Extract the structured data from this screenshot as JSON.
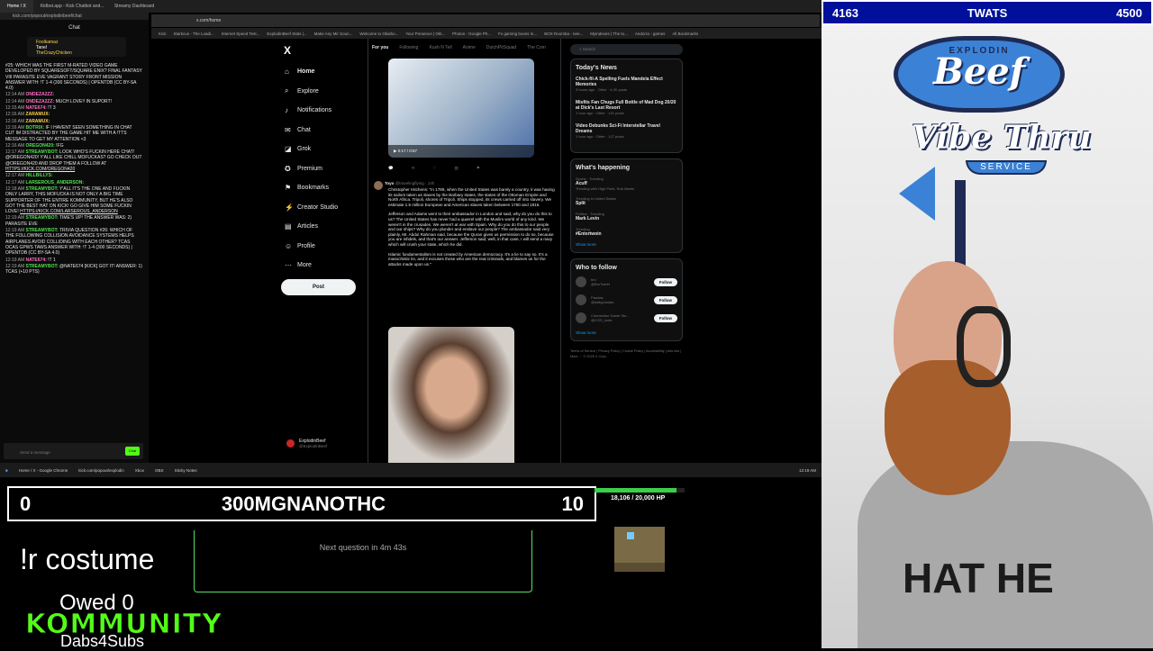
{
  "browser": {
    "tabs": [
      "Home / X",
      "Kidbot.app - Kick Chatbot and...",
      "Streamy Dashboard"
    ],
    "left_url": "kick.com/popout/explodinbeef/chat",
    "main_url": "x.com/home",
    "bookmarks": [
      "Kick",
      "Starkcus - The Loadi...",
      "Internet Speed Test...",
      "ExplodinBeef Stats |...",
      "Make Any Mir Soun...",
      "Welcome to Okiaho...",
      "Your Presence | Okt...",
      "Photos - Google Ph...",
      "Fx gaming boxes m...",
      "BOX Roomba - nee...",
      "Myindexes | The to...",
      "Andorra - games",
      "All Bookmarks"
    ]
  },
  "chat": {
    "title": "Chat",
    "pinned": [
      "Foolkamaz",
      "Tanel",
      "TheCrazyChicken"
    ],
    "messages": [
      {
        "ts": "",
        "user": "",
        "color": "",
        "text": "#25: WHICH WAS THE FIRST M-RATED VIDEO GAME DEVELOPED BY SQUARESOFT/SQUARE ENIX? FINAL FANTASY VIII PARASITE EVE VAGRANT STORY FRONT MISSION ANSWER WITH: !T 1-4 (300 SECONDS) | OPENTDB (CC BY-SA 4.0)"
      },
      {
        "ts": "12:14 AM",
        "user": "ondeza2zz:",
        "color": "pink",
        "text": ""
      },
      {
        "ts": "12:14 AM",
        "user": "ondeza2zz:",
        "color": "pink",
        "text": "MUCH LOVE!! in suport!"
      },
      {
        "ts": "12:15 AM",
        "user": "nate674:",
        "color": "pink",
        "text": "!t 3"
      },
      {
        "ts": "12:16 AM",
        "user": "Zaramux:",
        "color": "yellow",
        "text": ""
      },
      {
        "ts": "12:16 AM",
        "user": "Zaramux:",
        "color": "yellow",
        "text": ""
      },
      {
        "ts": "12:16 AM",
        "user": "BotRix:",
        "color": "",
        "text": "if I havent seen something in chat cut im distracted by the game hit me with a !tts message to get my attention <3"
      },
      {
        "ts": "12:16 AM",
        "user": "Oregon420:",
        "color": "",
        "text": "!fg"
      },
      {
        "ts": "12:17 AM",
        "user": "StreamyBot:",
        "color": "",
        "text": "LOOK WHO'S FUCKIN HERE CHAT! @OREGON420! Y'ALL LIKE CHILL MOFUCKAS? GO CHECK OUT @OREGON420 AND DROP THEM A FOLLOW AT",
        "link": "HTTPS://KICK.COM/OREGON420"
      },
      {
        "ts": "12:17 AM",
        "user": "Hillbillys:",
        "color": "",
        "text": ""
      },
      {
        "ts": "12:17 AM",
        "user": "Larserous_Anderson:",
        "color": "",
        "text": ""
      },
      {
        "ts": "12:18 AM",
        "user": "StreamyBot:",
        "color": "",
        "text": "Y'ALL IT'S THE ONE AND FUCKIN ONLY LARRY, THIS MOFUCKA IS NOT ONLY A BIG TIME SUPPORTER OF THE ENTIRE KOMMUNITY, BUT HE'S ALSO GOT THE BEST HAT ON KICK! GO GIVE HIM SOME FUCKIN LOVE!",
        "link": "HTTPS://KICK.COM/LARSEROUS_ANDERSON"
      },
      {
        "ts": "12:19 AM",
        "user": "StreamyBot:",
        "color": "",
        "text": "TIME'S UP! THE ANSWER WAS: 2) PARASITE EVE"
      },
      {
        "ts": "12:19 AM",
        "user": "StreamyBot:",
        "color": "",
        "text": "TRIVIA QUESTION #26: WHICH OF THE FOLLOWING COLLISION AVOIDANCE SYSTEMS HELPS AIRPLANES AVOID COLLIDING WITH EACH OTHER? TCAS OCAS GPWS TAWS ANSWER WITH: !T 1-4 (300 SECONDS) | OPENTDB (CC BY-SA 4.0)"
      },
      {
        "ts": "12:19 AM",
        "user": "nate674:",
        "color": "pink",
        "text": "!t 1"
      },
      {
        "ts": "12:19 AM",
        "user": "StreamyBot:",
        "color": "",
        "text": "@NATE674 [KICK] GOT IT! ANSWER: 1) TCAS (+10 PTS)"
      }
    ],
    "input_placeholder": "Send a message",
    "send_label": "Chat"
  },
  "x": {
    "logo": "X",
    "nav": [
      {
        "icon": "⌂",
        "label": "Home"
      },
      {
        "icon": "⌕",
        "label": "Explore"
      },
      {
        "icon": "♪",
        "label": "Notifications"
      },
      {
        "icon": "✉",
        "label": "Chat"
      },
      {
        "icon": "◪",
        "label": "Grok"
      },
      {
        "icon": "✪",
        "label": "Premium"
      },
      {
        "icon": "⚑",
        "label": "Bookmarks"
      },
      {
        "icon": "⚡",
        "label": "Creator Studio"
      },
      {
        "icon": "▤",
        "label": "Articles"
      },
      {
        "icon": "☺",
        "label": "Profile"
      },
      {
        "icon": "⋯",
        "label": "More"
      }
    ],
    "post_label": "Post",
    "profile": {
      "name": "ExplodinBeef",
      "handle": "@ExplodinBeef"
    },
    "feed_tabs": [
      "For you",
      "Following",
      "Kush N Tell",
      "Anime",
      "DutchPitSquad",
      "The Com"
    ],
    "video1_time": "0:17 / 0:57",
    "tweet": {
      "author": "Toyo",
      "handle": "@travelingflying · 14h",
      "paragraphs": [
        "Christopher Hitchens: \"In 1786, when the United States was barely a country, it was having its sailors taken as slaves by the Barbary states, the states of the Ottoman Empire and North Africa. Tripoli, shores of Tripoli. Ships stopped, its crews carried off into slavery. We estimate 1.5 million European and American slaves taken between 1750 and 1815.",
        "Jefferson and Adams went to their ambassador in London and said, why do you do this to us? The United States has never had a quarrel with the Muslim world of any kind. We weren't in the crusades. We weren't at war with Spain. Why do you do this to our people and our ships? Why do you plunder and enslave our people? The ambassador said very plainly, Mr. Abdul Rahman said, because the Quran gives us permission to do so, because you are infidels, and that's our answer. Jefferson said, well, in that case, I will send a navy which will crush your state, which he did.",
        "Islamic fundamentalism is not created by American democracy. It's a lie to say so. It's a masochistic lie, and it excuses those who are the real criminals, and blames us for the attacks made upon us.\""
      ]
    },
    "search_placeholder": "Search",
    "news_title": "Today's News",
    "news": [
      {
        "title": "Chick-fil-A Spelling Fuels Mandela Effect Memories",
        "meta": "3 hours ago · Other · 4.2K posts"
      },
      {
        "title": "Misfits Fan Chugs Full Bottle of Mad Dog 20/20 at Dick's Last Resort",
        "meta": "1 hour ago · Other · 141 posts"
      },
      {
        "title": "Video Debunks Sci-Fi Interstellar Travel Dreams",
        "meta": "1 hour ago · Other · 127 posts"
      }
    ],
    "happening_title": "What's happening",
    "trends": [
      {
        "cat": "Sports · Trending",
        "name": "Acuff",
        "sub": "Trending with High Point, Rob Martin"
      },
      {
        "cat": "Trending in United States",
        "name": "Split",
        "sub": ""
      },
      {
        "cat": "Politics · Trending",
        "name": "Mark Levin",
        "sub": ""
      },
      {
        "cat": "Trending",
        "name": "#Entertwoin",
        "sub": ""
      }
    ],
    "show_more": "Show more",
    "follow_title": "Who to follow",
    "follow": [
      {
        "name": "bro",
        "handle": "@BroTweet"
      },
      {
        "name": "Pandas",
        "handle": "@dailypandas"
      },
      {
        "name": "Connection Game Stu...",
        "handle": "@CGS_Indie"
      }
    ],
    "follow_label": "Follow",
    "footer": "Terms of Service | Privacy Policy | Cookie Policy | Accessibility | Ads info | More ··· © 2025 X Corp."
  },
  "taskbar": {
    "apps": [
      "Home / X - Google Chrome",
      "kick.com/popout/explodin",
      "Xbox",
      "OBS",
      "Sticky Notes"
    ],
    "clock": "12:19 AM"
  },
  "overlay": {
    "score_left": "4163",
    "score_title": "TWATS",
    "score_right": "4500",
    "logo_top": "EXPLODIN",
    "logo_beef": "Beef",
    "logo_vibe": "Vibe Thru",
    "logo_service": "SERVICE",
    "shirt_text": "HAT HE",
    "trivia_left": "0",
    "trivia_title": "300MGNANOTHC",
    "trivia_right": "10",
    "hp_text": "18,106 / 20,000 HP",
    "hp_fraction": 0.905,
    "next_question": "Next question in 4m 43s",
    "command": "!r costume",
    "owed": "Owed 0",
    "kommunity": "KOMMUNITY",
    "dabs": "Dabs4Subs"
  }
}
